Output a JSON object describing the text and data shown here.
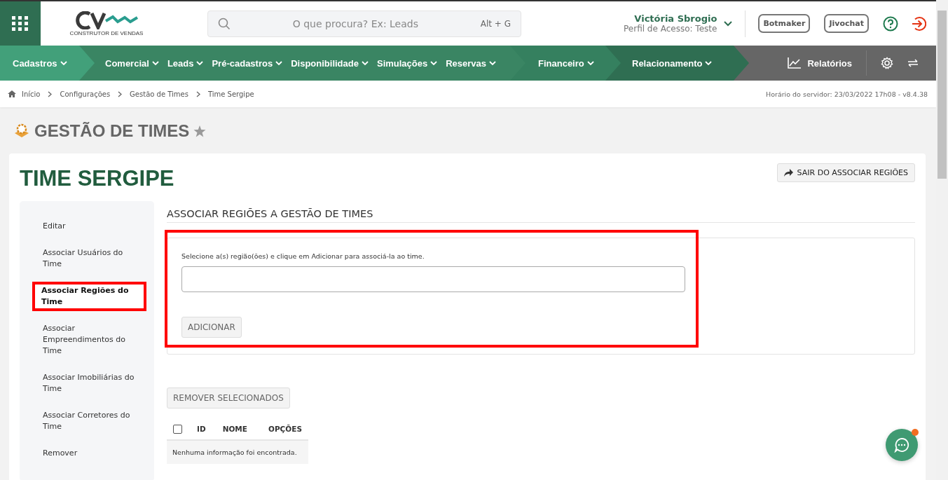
{
  "header": {
    "logo_text": "CONSTRUTOR DE VENDAS",
    "search": {
      "placeholder": "O que procura? Ex: Leads",
      "shortcut": "Alt + G"
    },
    "user": {
      "name": "Victória Sbrogio",
      "profile": "Perfil de Acesso: Teste"
    },
    "buttons": [
      "Botmaker",
      "Jivochat"
    ]
  },
  "nav": {
    "groups": [
      {
        "items": [
          "Cadastros"
        ]
      },
      {
        "items": [
          "Comercial",
          "Leads",
          "Pré-cadastros",
          "Disponibilidade",
          "Simulações",
          "Reservas"
        ]
      },
      {
        "items": [
          "Financeiro"
        ]
      },
      {
        "items": [
          "Relacionamento"
        ]
      }
    ],
    "reports": "Relatórios"
  },
  "breadcrumb": {
    "items": [
      "Início",
      "Configurações",
      "Gestão de Times",
      "Time Sergipe"
    ],
    "server_time": "Horário do servidor: 23/03/2022 17h08 - v8.4.38"
  },
  "page_title": "GESTÃO DE TIMES",
  "team_title": "TIME SERGIPE",
  "exit_button": "SAIR DO ASSOCIAR REGIÕES",
  "sidebar": {
    "items": [
      {
        "label": "Editar",
        "selected": false
      },
      {
        "label": "Associar Usuários do Time",
        "selected": false
      },
      {
        "label": "Associar Regiões do Time",
        "selected": true
      },
      {
        "label": "Associar Empreendimentos do Time",
        "selected": false
      },
      {
        "label": "Associar Imobiliárias do Time",
        "selected": false
      },
      {
        "label": "Associar Corretores do Time",
        "selected": false
      },
      {
        "label": "Remover",
        "selected": false
      }
    ]
  },
  "section": {
    "title": "ASSOCIAR REGIÕES A GESTÃO DE TIMES",
    "instruction": "Selecione a(s) região(ões) e clique em Adicionar para associá-la ao time.",
    "add_button": "ADICIONAR",
    "remove_button": "REMOVER SELECIONADOS"
  },
  "table": {
    "select_all": {
      "checked": false
    },
    "columns": [
      "ID",
      "NOME",
      "OPÇÕES"
    ],
    "empty": "Nenhuma informação foi encontrada."
  }
}
